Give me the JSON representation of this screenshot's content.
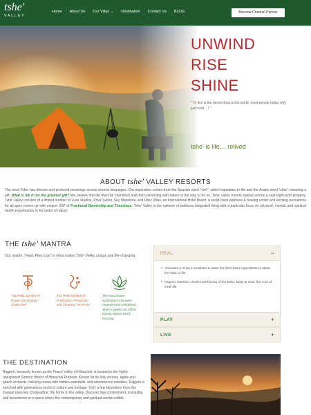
{
  "brand": {
    "logo_text": "tshe'",
    "logo_sub": "VALLEY"
  },
  "nav": {
    "items": [
      {
        "label": "Home"
      },
      {
        "label": "About Us"
      },
      {
        "label": "Our Villas ⌄"
      },
      {
        "label": "Destination"
      },
      {
        "label": "Contact Us"
      },
      {
        "label": "BLOG"
      }
    ],
    "cta_label": "Become Channel Partner"
  },
  "hero": {
    "title_lines": [
      "UNWIND",
      "RISE",
      "SHINE"
    ],
    "quote": "\" To live is the rarest thing is the world, most people today only just exist ...! \"",
    "tagline": "tshe' is life… relived"
  },
  "about": {
    "title_prefix": "ABOUT ",
    "title_brand": "tshe'",
    "title_suffix": " VALLEY RESORTS",
    "p1": "The word Tshe' has diverse and profound meanings across several languages. Our inspiration comes from the Spanish word \"vivir\", which translates to life and the Arabic word \"shai\", meaning a gift. ",
    "p1_highlight": "What is life if not the greatest gift?",
    "p2": " We believe that life must be cherished and that connecting with nature is the way to do so. Tshe' valley resorts spread across a vast eight-acre property, Tshe' valley consists of a limited number of Luxe Studios, Privé Suites, Sky Mansions, and Uber Villas, an International Hotel Brand, a world-class wellness & healing center and exciting recreations for all ages comes up with unique USP of ",
    "p2_highlight": "Fractional Ownership and Timeshare",
    "p3": ". Tshe' Valley is the epitome of wellness integrated living with a particular focus on physical, mental, and spiritual health rejuvenation in the midst of nature."
  },
  "mantra": {
    "title_prefix": "THE ",
    "title_brand": "tshe'",
    "title_suffix": " MANTRA",
    "subtitle": "Our maxim, \"Heal, Play, Live\" is what makes Tshe' Valley unique and life-changing.",
    "symbols": [
      {
        "icon": "reiki-power-icon",
        "text": "The Reiki Symbol of Power and Energy \" Choku Rei\""
      },
      {
        "icon": "reiki-purification-icon",
        "text": "The Reiki Symbol of Purification, Protection and Clearing \"Sei He Ki\""
      },
      {
        "icon": "lotus-icon",
        "text": "The lotus flower symbolizes Life ever-renewed and revitalized when it peeks out of the muddy waters every morning."
      }
    ]
  },
  "accordion": {
    "heal_label": "HEAL",
    "heal_sign": "−",
    "heal_items": [
      "Abundance of pure sunshine & water the life's basic ingredients to attain the elixir of life.",
      "Organic Nutrition creates well-being of the Mind, Body & Soul, the core of a full life"
    ],
    "play_label": "PLAY",
    "play_sign": "+",
    "live_label": "LIVE",
    "live_sign": "+"
  },
  "destination": {
    "title": "THE DESTINATION",
    "text": "Rajgarh, famously known as the Peach Valley of Himachal, is located in the highly unexplored Sirmour district of Himachal Pradesh. Known for its holy shrines, apple and peach orchards, trekking routes with hidden waterfalls, and adventurous activities. Rajgarh is enriched with generations worth of culture and heritage. Only a few kilometers from this tranquil town lies Churwadhar, the home to the valley. Discover true contentment, tranquility, and benediction in a space where the contemporary and spiritual worlds collide."
  }
}
